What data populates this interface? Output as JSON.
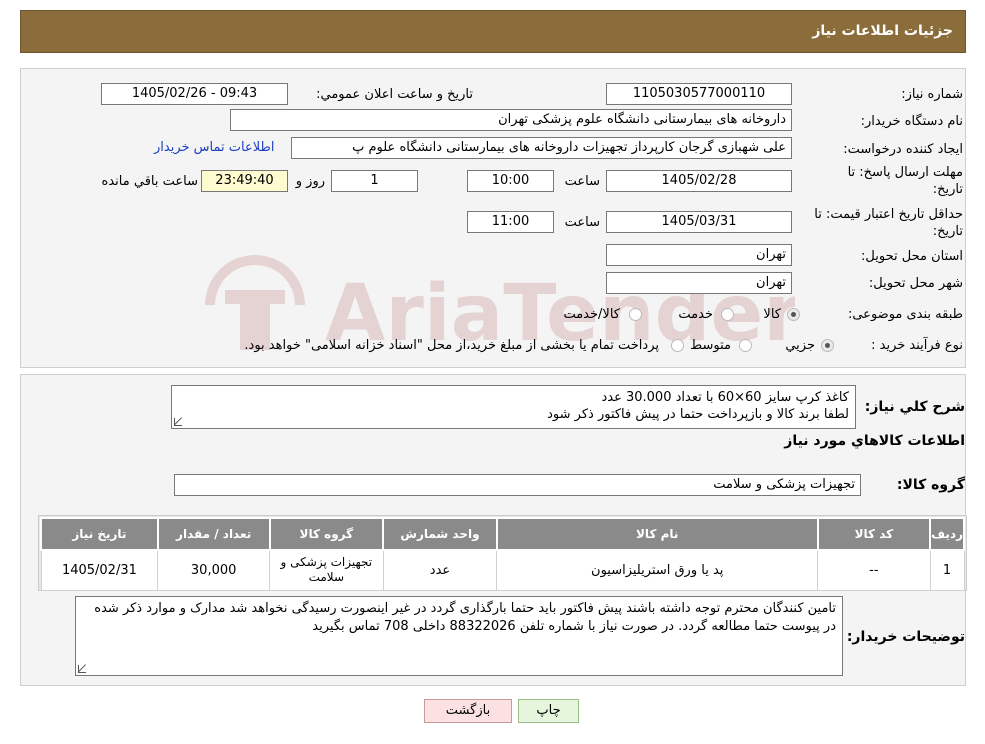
{
  "header": {
    "title": "جزئیات اطلاعات نیاز"
  },
  "form": {
    "need_number_label": "شماره نیاز:",
    "need_number": "1105030577000110",
    "announce_label": "تاریخ و ساعت اعلان عمومي:",
    "announce_value": "1405/02/26 - 09:43",
    "buyer_org_label": "نام دستگاه خريدار:",
    "buyer_org": "داروخانه های بیمارستانی دانشگاه علوم پزشکی تهران",
    "requester_label": "ايجاد کننده درخواست:",
    "requester": "علی شهبازی گرجان کارپرداز تجهیزات داروخانه های بیمارستانی دانشگاه علوم پ",
    "contact_link": "اطلاعات تماس خريدار",
    "deadline_label_1": "مهلت ارسال پاسخ: تا",
    "deadline_label_2": "تاريخ:",
    "deadline_date": "1405/02/28",
    "time_label": "ساعت",
    "deadline_time": "10:00",
    "days_value": "1",
    "days_label": "روز و",
    "remaining_time": "23:49:40",
    "remaining_label": "ساعت باقي مانده",
    "validity_label_1": "حداقل تاريخ اعتبار قيمت: تا",
    "validity_label_2": "تاريخ:",
    "validity_date": "1405/03/31",
    "validity_time": "11:00",
    "province_label": "استان محل تحويل:",
    "province": "تهران",
    "city_label": "شهر محل تحويل:",
    "city": "تهران",
    "category_label": "طبقه بندی موضوعی:",
    "category_options": [
      "کالا",
      "خدمت",
      "کالا/خدمت"
    ],
    "category_selected": "کالا",
    "purchase_type_label": "نوع فرآيند خريد :",
    "purchase_options": [
      "جزيي",
      "متوسط"
    ],
    "purchase_selected": "جزيي",
    "purchase_note": "پرداخت تمام یا بخشی از مبلغ خرید،از محل \"اسناد خزانه اسلامی\" خواهد بود."
  },
  "details": {
    "summary_label": "شرح كلي نياز:",
    "summary_line1": "کاغذ کرپ سایز 60×60  با تعداد 30.000 عدد",
    "summary_line2": "لطفا برند کالا و بازپرداخت حتما در پیش فاکتور ذکر شود",
    "goods_info_title": "اطلاعات كالاهاي مورد نياز",
    "goods_group_label": "گروه کالا:",
    "goods_group": "تجهیزات پزشکی و سلامت",
    "table": {
      "headers": [
        "رديف",
        "کد کالا",
        "نام کالا",
        "واحد شمارش",
        "گروه کالا",
        "تعداد / مقدار",
        "تاريخ نياز"
      ],
      "rows": [
        [
          "1",
          "--",
          "پد یا ورق استریلیزاسیون",
          "عدد",
          "تجهيزات پزشکی و سلامت",
          "30,000",
          "1405/02/31"
        ]
      ]
    },
    "buyer_notes_label": "توضيحات خريدار:",
    "buyer_notes": "تامین کنندگان محترم توجه داشته باشند پیش فاکتور باید حتما بارگذاری گردد در غیر اینصورت رسیدگی نخواهد شد مدارک و موارد ذکر شده در پیوست حتما مطالعه گردد. در صورت نیاز با شماره تلفن 88322026 داخلی 708 تماس بگیرید"
  },
  "buttons": {
    "print": "چاپ",
    "back": "بازگشت"
  },
  "watermark_text": "AriaTender.neT",
  "colors": {
    "header": "#8a6d3b",
    "table_header": "#8a8a8a",
    "link": "#1a3fc0"
  }
}
